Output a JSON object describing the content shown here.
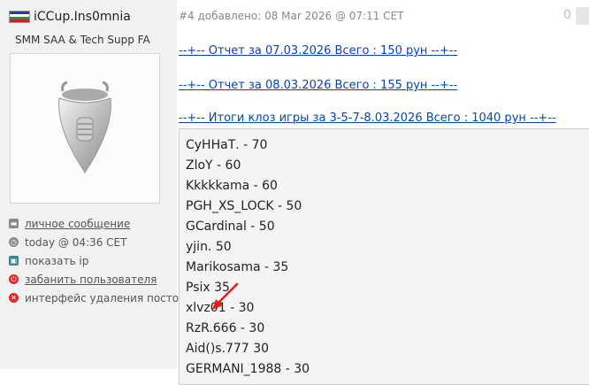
{
  "user": {
    "username": "iCCup.Ins0mnia",
    "title": "SMM SAA & Tech Supp FA",
    "actions": [
      {
        "label": "личное сообщение",
        "icon": "message-icon",
        "link": true
      },
      {
        "label": "today @ 04:36 CET",
        "icon": "clock-icon",
        "link": false
      },
      {
        "label": "показать ip",
        "icon": "ip-icon",
        "link": false
      },
      {
        "label": "забанить пользователя",
        "icon": "ban-icon",
        "link": true
      },
      {
        "label": "интерфейс удаления постов",
        "icon": "delete-icon",
        "link": false
      }
    ]
  },
  "post": {
    "meta": "#4 добавлено: 08 Mar 2026 @ 07:11 CET",
    "likes": "0",
    "links": [
      "--+-- Отчет за 07.03.2026 Всего : 150 рун --+--",
      "--+-- Отчет за 08.03.2026 Всего : 155 рун --+--",
      "--+-- Итоги клоз игры за 3-5-7-8.03.2026 Всего : 1040 рун --+--"
    ],
    "results": [
      "СуННаТ. - 70",
      "ZloY - 60",
      "Kkkkkama - 60",
      "PGH_XS_LOCK - 50",
      "GCardinal - 50",
      "yjin. 50",
      "Marikosama - 35",
      "Psix 35",
      "xlvz01 - 30",
      "RzR.666 - 30",
      "Aid()s.777 30",
      "GERMANI_1988 - 30"
    ]
  },
  "colors": {
    "link": "#0645ad",
    "arrow": "#e0201b",
    "panel": "#f1f1f1"
  }
}
